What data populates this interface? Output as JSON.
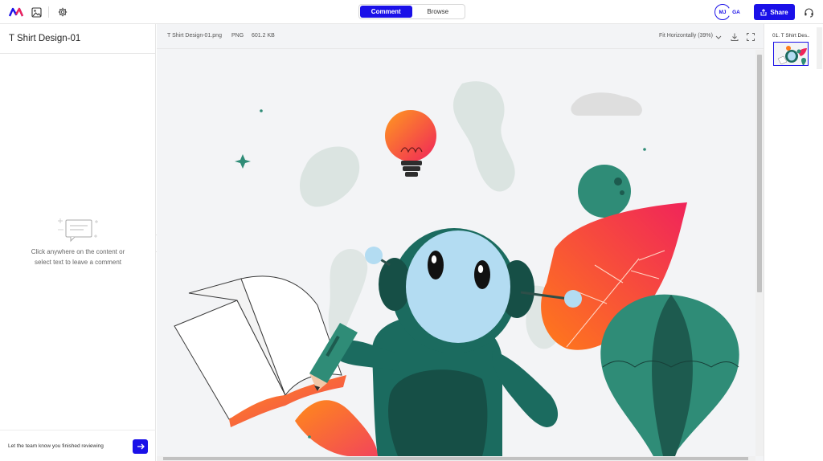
{
  "header": {
    "mode_tabs": [
      "Comment",
      "Browse"
    ],
    "avatars": [
      "MJ",
      "GA"
    ],
    "share_label": "Share"
  },
  "left_panel": {
    "title": "T Shirt Design-01",
    "empty_line1": "Click anywhere on the content or",
    "empty_line2": "select text to leave a comment",
    "footer_text": "Let the team know you finished reviewing"
  },
  "viewer": {
    "file_name": "T Shirt Design-01.png",
    "file_type": "PNG",
    "file_size": "601.2 KB",
    "zoom": "Fit Horizontally (39%)"
  },
  "right_panel": {
    "thumb_label": "01. T Shirt Des..."
  },
  "colors": {
    "accent": "#1a10e8",
    "robot_green": "#1b6b5f",
    "face": "#b3dcf2",
    "leaf_orange": "#ff7a1a",
    "leaf_pink": "#f0245a"
  }
}
